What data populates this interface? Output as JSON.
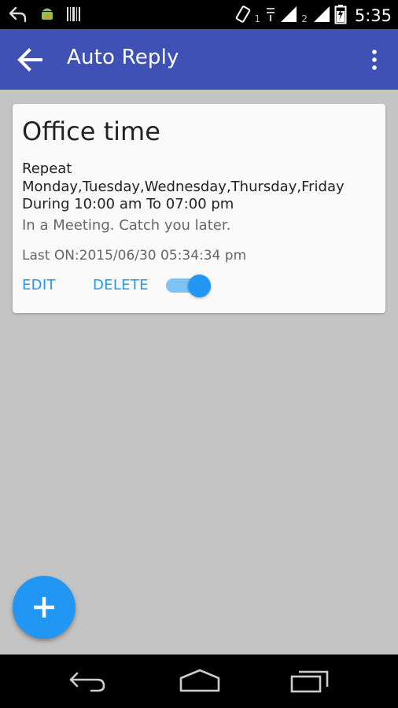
{
  "status_bar": {
    "sim1": "1",
    "sim2": "2",
    "time": "5:35"
  },
  "app_bar": {
    "title": "Auto Reply"
  },
  "rule": {
    "title": "Office time",
    "repeat_label": "Repeat",
    "days": "Monday,Tuesday,Wednesday,Thursday,Friday",
    "during": "During 10:00 am To 07:00 pm",
    "message": "In a Meeting. Catch you later.",
    "last_on": "Last ON:2015/06/30 05:34:34 pm",
    "edit_label": "EDIT",
    "delete_label": "DELETE",
    "enabled": true
  },
  "colors": {
    "app_bar": "#3f51b5",
    "accent": "#2196f3",
    "background": "#c4c4c4"
  }
}
